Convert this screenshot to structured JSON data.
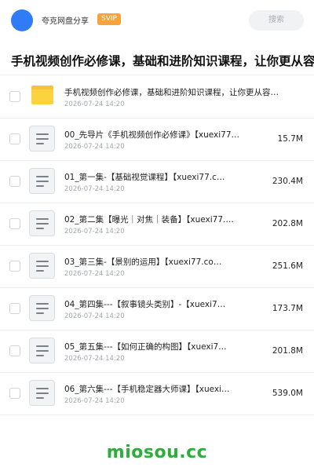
{
  "header": {
    "share_name": "夸克网盘分享",
    "badge": "SVIP",
    "search_placeholder": "搜索"
  },
  "title": "手机视频创作必修课，基础和进阶知识课程，让你更从容自",
  "files": [
    {
      "type": "folder",
      "name": "手机视频创作必修课，基础和进阶知识课程，让你更从容…",
      "date": "2026-07-24 14:20",
      "size": ""
    },
    {
      "type": "file",
      "name": "00_先导片《手机视频创作必修课》【xuexi77…",
      "date": "2026-07-24 14:20",
      "size": "15.7M"
    },
    {
      "type": "file",
      "name": "01_第一集-【基础视觉课程】【xuexi77.c…",
      "date": "2026-07-24 14:20",
      "size": "230.4M"
    },
    {
      "type": "file",
      "name": "02_第二集【曝光｜对焦｜装备】【xuexi77.…",
      "date": "2026-07-24 14:20",
      "size": "202.8M"
    },
    {
      "type": "file",
      "name": "03_第三集-【景别的运用】【xuexi77.co…",
      "date": "2026-07-24 14:20",
      "size": "251.6M"
    },
    {
      "type": "file",
      "name": "04_第四集---【叙事镜头类别】-【xuexi7…",
      "date": "2026-07-24 14:20",
      "size": "173.7M"
    },
    {
      "type": "file",
      "name": "05_第五集---【如何正确的构图】【xuexi7…",
      "date": "2026-07-24 14:20",
      "size": "201.8M"
    },
    {
      "type": "file",
      "name": "06_第六集---【手机稳定器大师课】【xuexi…",
      "date": "2026-07-24 14:20",
      "size": "539.0M"
    }
  ],
  "watermark": "miosou.cc",
  "colors": {
    "accent": "#2f7cf6",
    "badge": "#f7a23b",
    "folder": "#fdd23f",
    "watermark": "#2cae3b"
  }
}
